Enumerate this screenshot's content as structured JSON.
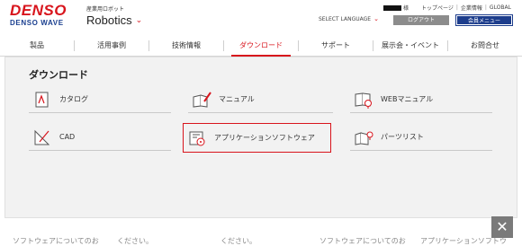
{
  "header": {
    "logo_text": "DENSO",
    "logo_sub": "DENSO WAVE",
    "brand_sub": "産業用ロボット",
    "brand_main": "Robotics",
    "user_suffix": "様",
    "util_links": [
      "トップページ",
      "企業情報",
      "GLOBAL"
    ],
    "language_label": "SELECT LANGUAGE",
    "logout_label": "ログアウト",
    "member_menu_label": "会員メニュー"
  },
  "nav": {
    "items": [
      {
        "label": "製品"
      },
      {
        "label": "活用事例"
      },
      {
        "label": "技術情報"
      },
      {
        "label": "ダウンロード"
      },
      {
        "label": "サポート"
      },
      {
        "label": "展示会・イベント"
      },
      {
        "label": "お問合せ"
      }
    ],
    "active_index": 3
  },
  "download_panel": {
    "title": "ダウンロード",
    "items": [
      {
        "label": "カタログ",
        "icon": "catalog-icon"
      },
      {
        "label": "マニュアル",
        "icon": "manual-icon"
      },
      {
        "label": "WEBマニュアル",
        "icon": "web-manual-icon"
      },
      {
        "label": "CAD",
        "icon": "cad-icon"
      },
      {
        "label": "アプリケーションソフトウェア",
        "icon": "application-software-icon"
      },
      {
        "label": "パーツリスト",
        "icon": "parts-list-icon"
      }
    ],
    "selected_index": 4
  },
  "background_strip": {
    "texts": [
      "ソフトウェアについてのお",
      "ください。",
      "ください。",
      "ソフトウェアについてのお",
      "アプリケーションソフトウ"
    ]
  },
  "close_label": "✕",
  "colors": {
    "accent": "#d8141c",
    "navy": "#1d3d8c",
    "panel_bg": "#f2f2f2"
  }
}
